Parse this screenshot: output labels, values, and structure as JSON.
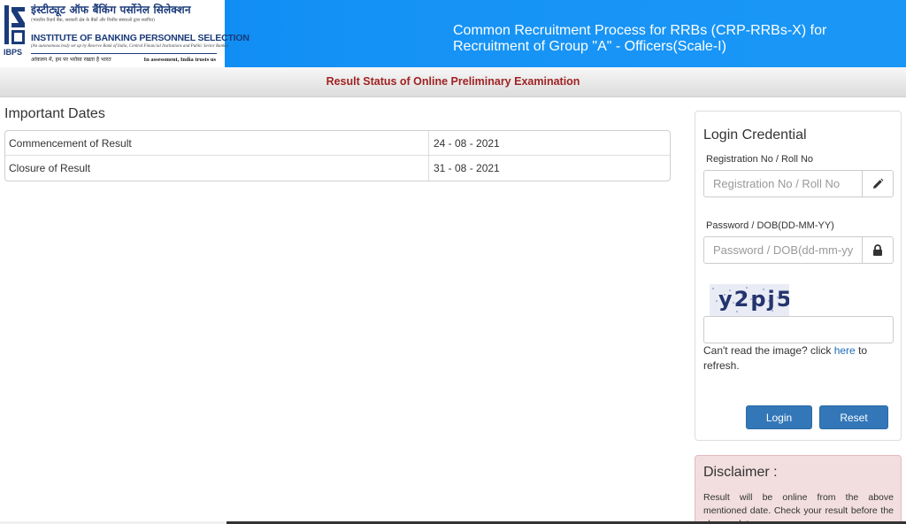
{
  "header": {
    "logo": {
      "hindi_name": "इंस्टीट्यूट ऑफ बैंकिंग पर्सोनेल सिलेक्शन",
      "hindi_subtitle": "(भारतीय रिज़र्व बैंक, सरकारी क्षेत्र के बैंकों और वित्तीय संस्थाओं द्वारा स्थापित)",
      "name": "INSTITUTE OF BANKING PERSONNEL SELECTION",
      "subtitle": "(An autonomous body set up by Reserve Bank of India, Central Financial Institutions and Public Sector Banks)",
      "tagline_hindi": "आंकलन में, हम पर भरोसा रखता है भारत",
      "tagline_english": "In assessment, India trusts us",
      "abbr": "IBPS"
    },
    "title": "Common Recruitment Process for RRBs (CRP-RRBs-X) for Recruitment of Group \"A\" - Officers(Scale-I)"
  },
  "subheader": {
    "title": "Result Status of Online Preliminary Examination"
  },
  "important_dates": {
    "title": "Important Dates",
    "rows": [
      {
        "label": "Commencement of Result",
        "value": "24 - 08 - 2021"
      },
      {
        "label": "Closure of Result",
        "value": "31 - 08 - 2021"
      }
    ]
  },
  "login": {
    "title": "Login Credential",
    "registration_label": "Registration No / Roll No",
    "registration_placeholder": "Registration No / Roll No",
    "registration_value": "",
    "password_label": "Password / DOB(DD-MM-YY)",
    "password_placeholder": "Password / DOB(dd-mm-yy)",
    "password_value": "",
    "captcha_text": "y2pj5",
    "captcha_value": "",
    "refresh_prefix": "Can't read the image? click ",
    "refresh_link": "here",
    "refresh_suffix": " to refresh.",
    "login_button": "Login",
    "reset_button": "Reset"
  },
  "disclaimer": {
    "title": "Disclaimer :",
    "text": "Result will be online from the above mentioned date. Check your result before the closure date."
  },
  "colors": {
    "header_blue": "#1592f5",
    "subheader_text": "#a12222",
    "button_blue": "#3377b8",
    "disclaimer_bg": "#f2dede"
  },
  "icons": {
    "registration_addon": "pencil-icon",
    "password_addon": "lock-icon"
  }
}
